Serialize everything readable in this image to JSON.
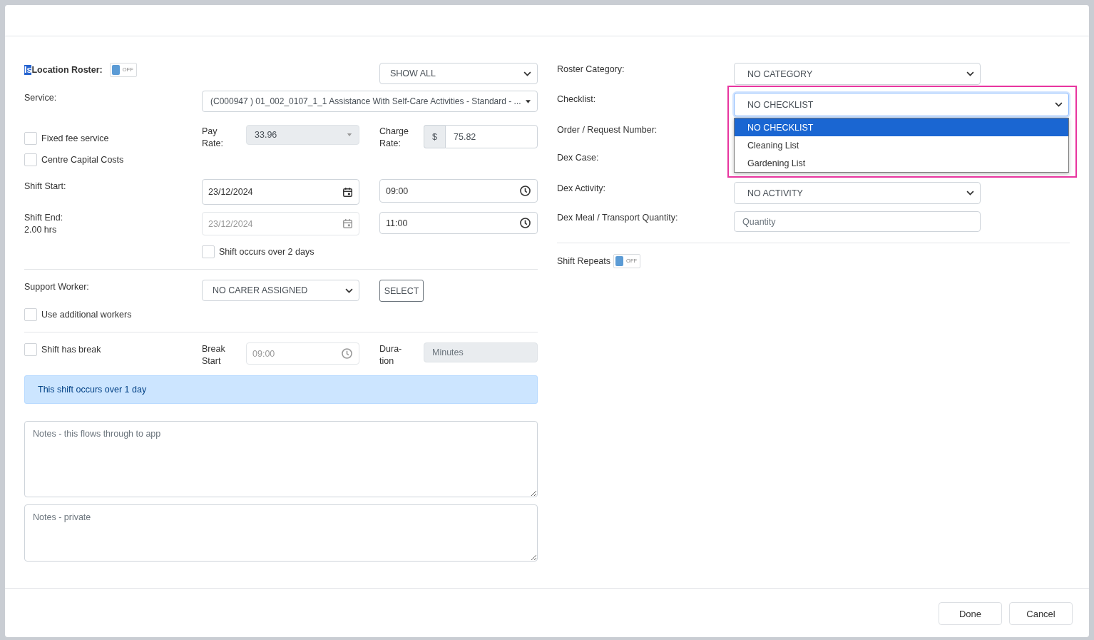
{
  "left": {
    "location_roster": {
      "selected_text": "Is",
      "label": "Location Roster:",
      "toggle": {
        "on": false,
        "text": "OFF"
      }
    },
    "show_select": {
      "value": "SHOW ALL"
    },
    "service": {
      "label": "Service:",
      "value": "(C000947 ) 01_002_0107_1_1 Assistance With Self-Care Activities - Standard - ..."
    },
    "top_checkboxes": [
      {
        "label": "Fixed fee service",
        "checked": false
      },
      {
        "label": "Centre Capital Costs",
        "checked": false
      }
    ],
    "pay_rate": {
      "label": "Pay Rate:",
      "value": "33.96",
      "disabled": true
    },
    "charge_rate": {
      "label": "Charge Rate:",
      "prefix": "$",
      "value": "75.82"
    },
    "shift_start": {
      "label": "Shift Start:",
      "date": {
        "value": "23/12/2024",
        "disabled": false
      },
      "time": {
        "value": "09:00"
      }
    },
    "shift_end": {
      "label": "Shift End:",
      "hours": "2.00 hrs",
      "date": {
        "value": "23/12/2024",
        "disabled": true
      },
      "time": {
        "value": "11:00"
      }
    },
    "over_two_days": {
      "label": "Shift occurs over 2 days",
      "checked": false
    },
    "support_worker": {
      "label": "Support Worker:",
      "value": "NO CARER ASSIGNED",
      "button": "SELECT"
    },
    "additional_workers": {
      "label": "Use additional workers",
      "checked": false
    },
    "has_break": {
      "label": "Shift has break",
      "checked": false
    },
    "break_start": {
      "label": "Break Start",
      "value": "09:00",
      "disabled": true
    },
    "duration": {
      "label": "Dura-tion",
      "placeholder": "Minutes",
      "disabled": true
    },
    "info_message": "This shift occurs over 1 day",
    "notes": [
      {
        "placeholder": "Notes - this flows through to app"
      },
      {
        "placeholder": "Notes - private"
      }
    ]
  },
  "right": {
    "roster_category": {
      "label": "Roster Category:",
      "value": "NO CATEGORY"
    },
    "checklist": {
      "label": "Checklist:",
      "value": "NO CHECKLIST",
      "expanded": true,
      "highlighted": true,
      "options": [
        {
          "label": "NO CHECKLIST",
          "selected": true
        },
        {
          "label": "Cleaning List",
          "selected": false
        },
        {
          "label": "Gardening List",
          "selected": false
        }
      ]
    },
    "order_request_number": {
      "label": "Order / Request Number:"
    },
    "dex_case": {
      "label": "Dex Case:"
    },
    "dex_activity": {
      "label": "Dex Activity:",
      "value": "NO ACTIVITY"
    },
    "dex_meal_quantity": {
      "label": "Dex Meal / Transport Quantity:",
      "placeholder": "Quantity"
    },
    "shift_repeats": {
      "label": "Shift Repeats",
      "toggle": {
        "on": false,
        "text": "OFF"
      }
    }
  },
  "footer": {
    "buttons": [
      {
        "label": "Done"
      },
      {
        "label": "Cancel"
      }
    ]
  }
}
